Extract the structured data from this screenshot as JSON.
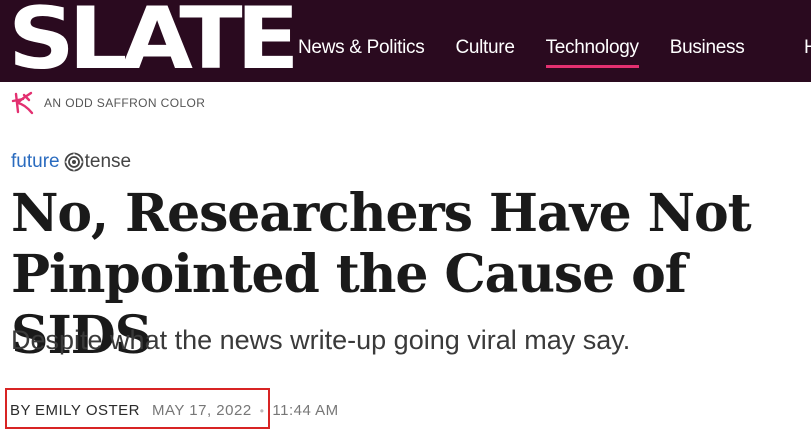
{
  "site": {
    "logo_text": "SLATE",
    "nav": [
      {
        "label": "News & Politics"
      },
      {
        "label": "Culture"
      },
      {
        "label": "Technology"
      },
      {
        "label": "Business"
      }
    ],
    "active_nav": "Technology",
    "colors": {
      "topbar": "#2a0a1f",
      "active_underline": "#e33070",
      "brand_blue": "#2a6bbf",
      "highlight_red": "#d82424"
    }
  },
  "sponsor": {
    "icon": "saffron-flower-icon",
    "label": "AN ODD SAFFRON COLOR"
  },
  "section_brand": {
    "future": "future",
    "icon": "future-tense-logo-icon",
    "tense": "tense"
  },
  "article": {
    "headline": "No, Researchers Have Not Pinpointed the Cause of SIDS",
    "dek": "Despite what the news write-up going viral may say.",
    "byline_prefix": "BY",
    "author": "EMILY OSTER",
    "date": "MAY 17, 2022",
    "separator": "•",
    "time": "11:44 AM"
  }
}
